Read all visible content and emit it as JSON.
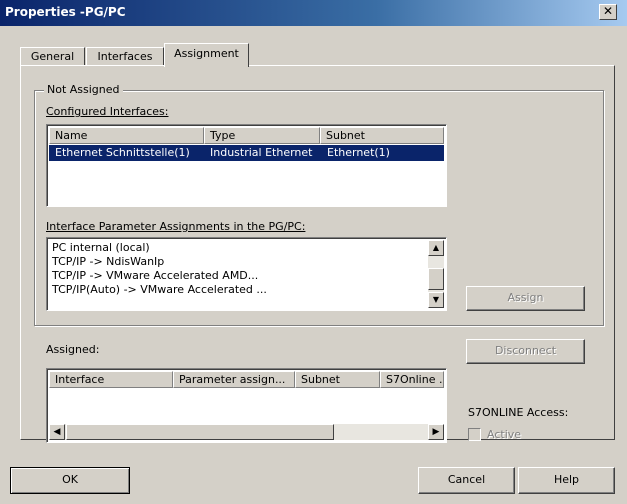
{
  "window": {
    "title": "Properties -PG/PC",
    "close_glyph": "✕"
  },
  "tabs": [
    {
      "label": "General",
      "selected": false
    },
    {
      "label": "Interfaces",
      "selected": false
    },
    {
      "label": "Assignment",
      "selected": true
    }
  ],
  "not_assigned": {
    "group_label": "Not Assigned",
    "configured_label": "Configured Interfaces:",
    "columns": [
      "Name",
      "Type",
      "Subnet"
    ],
    "rows": [
      {
        "name": "Ethernet Schnittstelle(1)",
        "type": "Industrial Ethernet",
        "subnet": "Ethernet(1)",
        "selected": true
      }
    ],
    "param_label": "Interface Parameter Assignments in the PG/PC:",
    "param_items": [
      "PC internal (local)",
      "TCP/IP -> NdisWanIp",
      "TCP/IP -> VMware Accelerated AMD...",
      "TCP/IP(Auto) -> VMware Accelerated ..."
    ],
    "assign_label": "Assign"
  },
  "assigned": {
    "label": "Assigned:",
    "columns": [
      "Interface",
      "Parameter assign...",
      "Subnet",
      "S7Online ."
    ],
    "disconnect_label": "Disconnect",
    "s7online_label": "S7ONLINE Access:",
    "active_label": "Active",
    "active_checked": false
  },
  "footer": {
    "ok_label": "OK",
    "cancel_label": "Cancel",
    "help_label": "Help"
  },
  "colors": {
    "titlebar_start": "#0a246a",
    "titlebar_end": "#a6caf0",
    "selection": "#0a246a",
    "face": "#d4d0c8"
  }
}
